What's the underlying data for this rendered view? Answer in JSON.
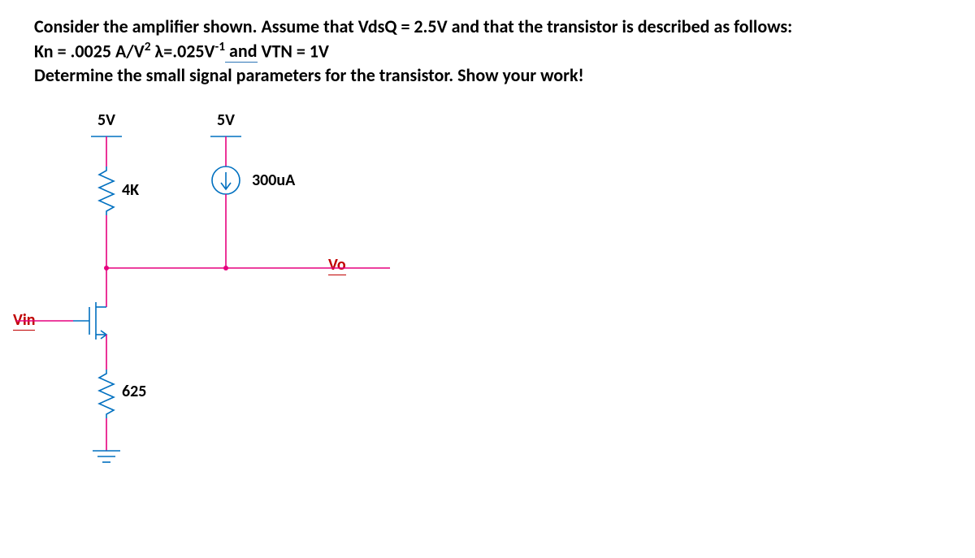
{
  "problem": {
    "line1a": "Consider the amplifier shown.  Assume that ",
    "vdsq": "VdsQ",
    "line1b": " = 2.5V and that the transistor is described as follows:",
    "kn_u": "Kn",
    "line2a": " = .0025 A/V",
    "sq": "2",
    "line2b": " λ=.025V",
    "neg1": "-1",
    "and_u": " and",
    "line2c": " VTN = 1V",
    "line3a": "Determine the small signal parameters for the transistor.  ",
    "line3b": "Show your work!"
  },
  "labels": {
    "supply_left": "5V",
    "supply_right": "5V",
    "r_top": "4K",
    "i_src": "300uA",
    "vo": "Vo",
    "vin": "Vin",
    "r_bot": "625"
  },
  "chart_data": {
    "type": "circuit",
    "title": "MOSFET amplifier small-signal parameter problem",
    "given": {
      "VdsQ_V": 2.5,
      "Kn_A_per_V2": 0.0025,
      "lambda_per_V": 0.025,
      "VTN_V": 1
    },
    "supplies": [
      {
        "node": "left_rail",
        "voltage_V": 5
      },
      {
        "node": "right_rail",
        "voltage_V": 5
      }
    ],
    "components": [
      {
        "ref": "R1",
        "type": "resistor",
        "value_ohm": 4000,
        "between": [
          "left_rail",
          "drain/Vo"
        ]
      },
      {
        "ref": "I1",
        "type": "current_source",
        "value_A": 0.0003,
        "direction": "down",
        "between": [
          "right_rail",
          "drain/Vo"
        ]
      },
      {
        "ref": "M1",
        "type": "nmos",
        "terminals": {
          "gate": "Vin",
          "drain": "drain/Vo",
          "source": "src"
        }
      },
      {
        "ref": "R2",
        "type": "resistor",
        "value_ohm": 625,
        "between": [
          "src",
          "gnd"
        ]
      }
    ],
    "ports": {
      "input": "Vin",
      "output": "Vo"
    }
  }
}
